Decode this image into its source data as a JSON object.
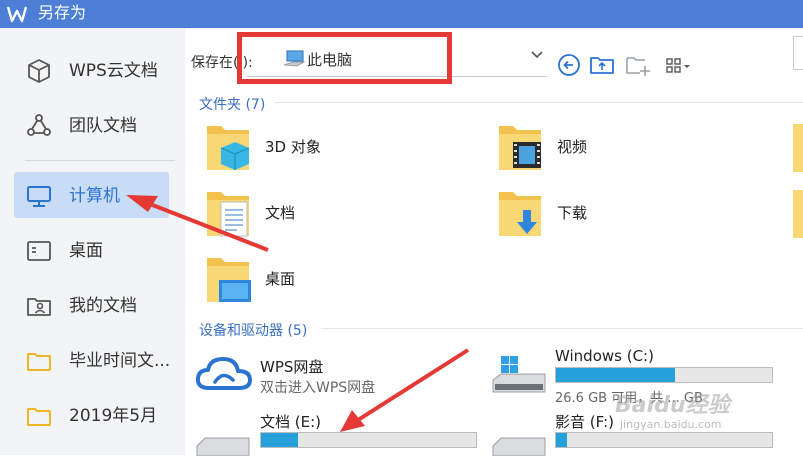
{
  "window": {
    "title": "另存为"
  },
  "sidebar": {
    "items": [
      {
        "label": "WPS云文档",
        "icon": "cube-icon"
      },
      {
        "label": "团队文档",
        "icon": "team-icon"
      },
      {
        "label": "计算机",
        "icon": "monitor-icon",
        "active": true
      },
      {
        "label": "桌面",
        "icon": "desktop-icon"
      },
      {
        "label": "我的文档",
        "icon": "user-folder-icon"
      },
      {
        "label": "毕业时间文...",
        "icon": "folder-icon"
      },
      {
        "label": "2019年5月",
        "icon": "folder-icon"
      }
    ]
  },
  "toolbar": {
    "save_in_label": "保存在(I):",
    "location": "此电脑"
  },
  "folders_section": {
    "header": "文件夹 (7)",
    "items": [
      {
        "name": "3D 对象",
        "icon": "3d-objects-folder-icon"
      },
      {
        "name": "视频",
        "icon": "videos-folder-icon"
      },
      {
        "name": "文档",
        "icon": "documents-folder-icon"
      },
      {
        "name": "下载",
        "icon": "downloads-folder-icon"
      },
      {
        "name": "桌面",
        "icon": "desktop-folder-icon"
      }
    ]
  },
  "devices_section": {
    "header": "设备和驱动器 (5)",
    "wps_drive": {
      "name": "WPS网盘",
      "subtitle": "双击进入WPS网盘"
    },
    "drives": [
      {
        "name": "Windows (C:)",
        "free_text": "26.6 GB 可用，共 ... GB",
        "used_fraction": 0.55
      },
      {
        "name": "文档 (E:)",
        "used_fraction": 0.17
      },
      {
        "name": "影音 (F:)",
        "used_fraction": 0.05
      }
    ]
  },
  "watermark": {
    "text": "Baidu经验",
    "sub": "jingyan.baidu.com"
  },
  "colors": {
    "titlebar": "#4d7fd6",
    "sidebar_active": "#c8dcf5",
    "accent_text": "#2b73d0",
    "annotation_red": "#e53935",
    "drive_fill": "#26a0da"
  }
}
